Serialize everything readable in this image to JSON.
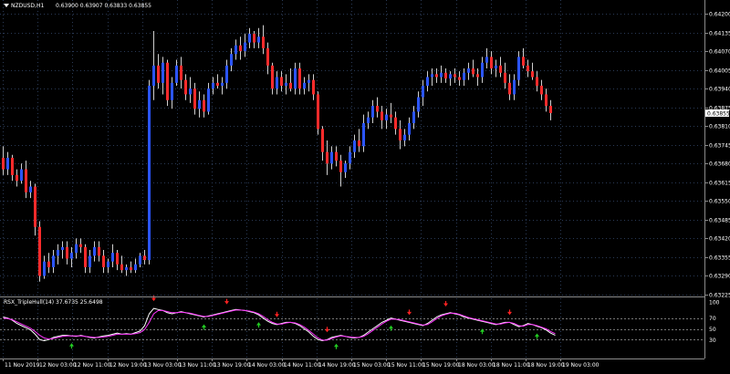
{
  "main": {
    "header": {
      "symbol": "NZDUSD,H1",
      "ohlc": "0.63900 0.63907 0.63833 0.63855"
    },
    "price_axis": [
      "0.64200",
      "0.64135",
      "0.64070",
      "0.64005",
      "0.63940",
      "0.63875",
      "0.63810",
      "0.63745",
      "0.63680",
      "0.63615",
      "0.63550",
      "0.63485",
      "0.63420",
      "0.63355",
      "0.63290",
      "0.63225"
    ],
    "current_price": "0.63855"
  },
  "indicator": {
    "title": "RSX_TripleHull(14) 37.6735 25.6498",
    "levels": [
      "100",
      "70",
      "50",
      "30"
    ]
  },
  "time_axis": [
    "11 Nov 2019",
    "12 Nov 03:00",
    "12 Nov 11:00",
    "12 Nov 19:00",
    "13 Nov 03:00",
    "13 Nov 11:00",
    "13 Nov 19:00",
    "14 Nov 03:00",
    "14 Nov 11:00",
    "14 Nov 19:00",
    "15 Nov 03:00",
    "15 Nov 11:00",
    "15 Nov 19:00",
    "18 Nov 03:00",
    "18 Nov 11:00",
    "18 Nov 19:00",
    "19 Nov 03:00"
  ],
  "colors": {
    "bull": "#2b55ff",
    "bear": "#ff2b2b",
    "grid": "#2a3a56",
    "rsx": "#ffffff",
    "signal": "#ff33ff",
    "arrow_up": "#22cc22",
    "arrow_down": "#ff2222"
  },
  "chart_data": [
    {
      "type": "candlestick",
      "title": "NZDUSD,H1",
      "x_start": "11 Nov 2019",
      "ylim": [
        0.63225,
        0.642
      ],
      "ohlc": [
        [
          0.637,
          0.6374,
          0.6364,
          0.6366
        ],
        [
          0.6366,
          0.6372,
          0.6364,
          0.637
        ],
        [
          0.637,
          0.6371,
          0.6362,
          0.6364
        ],
        [
          0.6364,
          0.6366,
          0.636,
          0.6362
        ],
        [
          0.6362,
          0.6368,
          0.6361,
          0.6366
        ],
        [
          0.6366,
          0.6369,
          0.6356,
          0.6358
        ],
        [
          0.6358,
          0.6362,
          0.6356,
          0.636
        ],
        [
          0.636,
          0.6361,
          0.6343,
          0.6346
        ],
        [
          0.6346,
          0.6348,
          0.6327,
          0.6329
        ],
        [
          0.6329,
          0.6336,
          0.6328,
          0.6334
        ],
        [
          0.6334,
          0.6337,
          0.633,
          0.6332
        ],
        [
          0.6332,
          0.6338,
          0.633,
          0.6336
        ],
        [
          0.6336,
          0.634,
          0.6333,
          0.6338
        ],
        [
          0.6338,
          0.6341,
          0.6335,
          0.6339
        ],
        [
          0.6339,
          0.6341,
          0.6333,
          0.6335
        ],
        [
          0.6335,
          0.6339,
          0.6332,
          0.6337
        ],
        [
          0.6337,
          0.6342,
          0.6335,
          0.634
        ],
        [
          0.634,
          0.6342,
          0.6337,
          0.6339
        ],
        [
          0.6339,
          0.634,
          0.633,
          0.6332
        ],
        [
          0.6332,
          0.6338,
          0.633,
          0.6336
        ],
        [
          0.6336,
          0.6341,
          0.6334,
          0.6339
        ],
        [
          0.6339,
          0.6341,
          0.6334,
          0.6336
        ],
        [
          0.6336,
          0.6338,
          0.633,
          0.6332
        ],
        [
          0.6332,
          0.6335,
          0.633,
          0.6334
        ],
        [
          0.6334,
          0.634,
          0.6332,
          0.6337
        ],
        [
          0.6337,
          0.6338,
          0.6331,
          0.6333
        ],
        [
          0.6333,
          0.6336,
          0.633,
          0.6331
        ],
        [
          0.6331,
          0.6333,
          0.6329,
          0.6332
        ],
        [
          0.6332,
          0.6334,
          0.633,
          0.6331
        ],
        [
          0.6331,
          0.6335,
          0.633,
          0.6333
        ],
        [
          0.6333,
          0.6337,
          0.6332,
          0.6336
        ],
        [
          0.6336,
          0.6338,
          0.6333,
          0.63345
        ],
        [
          0.63345,
          0.6397,
          0.6333,
          0.6395
        ],
        [
          0.6395,
          0.6414,
          0.639,
          0.6402
        ],
        [
          0.6402,
          0.6406,
          0.6394,
          0.6396
        ],
        [
          0.6396,
          0.6405,
          0.6392,
          0.6403
        ],
        [
          0.6403,
          0.6404,
          0.6388,
          0.639
        ],
        [
          0.639,
          0.6398,
          0.6387,
          0.6396
        ],
        [
          0.6396,
          0.6404,
          0.6395,
          0.6402
        ],
        [
          0.6402,
          0.6405,
          0.6394,
          0.6397
        ],
        [
          0.6397,
          0.6399,
          0.639,
          0.6392
        ],
        [
          0.6392,
          0.6398,
          0.6389,
          0.6394
        ],
        [
          0.6394,
          0.6396,
          0.6385,
          0.6387
        ],
        [
          0.6387,
          0.6393,
          0.6384,
          0.639
        ],
        [
          0.639,
          0.6392,
          0.6384,
          0.6386
        ],
        [
          0.6386,
          0.6396,
          0.6385,
          0.6394
        ],
        [
          0.6394,
          0.6398,
          0.6392,
          0.6396
        ],
        [
          0.6396,
          0.6399,
          0.6394,
          0.6395
        ],
        [
          0.6395,
          0.6398,
          0.6392,
          0.6396
        ],
        [
          0.6396,
          0.6404,
          0.6394,
          0.6402
        ],
        [
          0.6402,
          0.6408,
          0.64,
          0.6406
        ],
        [
          0.6406,
          0.6411,
          0.6404,
          0.6409
        ],
        [
          0.6409,
          0.6412,
          0.6404,
          0.6407
        ],
        [
          0.6407,
          0.6413,
          0.6405,
          0.641
        ],
        [
          0.641,
          0.6415,
          0.6408,
          0.6413
        ],
        [
          0.6413,
          0.6414,
          0.6408,
          0.641
        ],
        [
          0.641,
          0.6415,
          0.6408,
          0.6412
        ],
        [
          0.6412,
          0.6416,
          0.6406,
          0.6408
        ],
        [
          0.6408,
          0.641,
          0.6399,
          0.6402
        ],
        [
          0.6402,
          0.6403,
          0.6392,
          0.6394
        ],
        [
          0.6394,
          0.64,
          0.6392,
          0.6398
        ],
        [
          0.6398,
          0.64,
          0.6393,
          0.6395
        ],
        [
          0.6395,
          0.6399,
          0.6392,
          0.6396
        ],
        [
          0.6396,
          0.6401,
          0.6393,
          0.6394
        ],
        [
          0.6394,
          0.6403,
          0.6392,
          0.6401
        ],
        [
          0.6401,
          0.6403,
          0.6392,
          0.6394
        ],
        [
          0.6394,
          0.6398,
          0.6392,
          0.6396
        ],
        [
          0.6396,
          0.6399,
          0.6393,
          0.6397
        ],
        [
          0.6397,
          0.6399,
          0.639,
          0.6392
        ],
        [
          0.6392,
          0.6393,
          0.6378,
          0.638
        ],
        [
          0.638,
          0.6381,
          0.6369,
          0.6372
        ],
        [
          0.6372,
          0.6376,
          0.6364,
          0.6368
        ],
        [
          0.6368,
          0.6374,
          0.6366,
          0.6372
        ],
        [
          0.6372,
          0.6374,
          0.6367,
          0.6369
        ],
        [
          0.6369,
          0.6371,
          0.636,
          0.6365
        ],
        [
          0.6365,
          0.6369,
          0.6363,
          0.6368
        ],
        [
          0.6368,
          0.6374,
          0.6366,
          0.6372
        ],
        [
          0.6372,
          0.6378,
          0.637,
          0.6376
        ],
        [
          0.6376,
          0.638,
          0.6372,
          0.6374
        ],
        [
          0.6374,
          0.6385,
          0.6372,
          0.6382
        ],
        [
          0.6382,
          0.6386,
          0.638,
          0.6384
        ],
        [
          0.6384,
          0.639,
          0.6382,
          0.6388
        ],
        [
          0.6388,
          0.6391,
          0.6384,
          0.6386
        ],
        [
          0.6386,
          0.6388,
          0.638,
          0.6383
        ],
        [
          0.6383,
          0.6387,
          0.638,
          0.6385
        ],
        [
          0.6385,
          0.6389,
          0.6382,
          0.6384
        ],
        [
          0.6384,
          0.6386,
          0.6378,
          0.638
        ],
        [
          0.638,
          0.6383,
          0.6373,
          0.6376
        ],
        [
          0.6376,
          0.638,
          0.6374,
          0.6378
        ],
        [
          0.6378,
          0.6384,
          0.6376,
          0.6382
        ],
        [
          0.6382,
          0.6388,
          0.638,
          0.6386
        ],
        [
          0.6386,
          0.6393,
          0.6384,
          0.6391
        ],
        [
          0.6391,
          0.6397,
          0.6388,
          0.6395
        ],
        [
          0.6395,
          0.64,
          0.6393,
          0.6398
        ],
        [
          0.6398,
          0.6401,
          0.6395,
          0.6399
        ],
        [
          0.6399,
          0.6401,
          0.6396,
          0.6398
        ],
        [
          0.6398,
          0.6402,
          0.6396,
          0.63995
        ],
        [
          0.63995,
          0.6401,
          0.6396,
          0.63975
        ],
        [
          0.63975,
          0.64,
          0.6395,
          0.6399
        ],
        [
          0.6399,
          0.6401,
          0.6396,
          0.6398
        ],
        [
          0.6398,
          0.64,
          0.6395,
          0.6397
        ],
        [
          0.6397,
          0.6401,
          0.6395,
          0.63995
        ],
        [
          0.63995,
          0.6403,
          0.6397,
          0.6401
        ],
        [
          0.6401,
          0.6404,
          0.6398,
          0.6399
        ],
        [
          0.6399,
          0.6401,
          0.6395,
          0.6398
        ],
        [
          0.6398,
          0.6405,
          0.6396,
          0.6403
        ],
        [
          0.6403,
          0.6408,
          0.6401,
          0.6405
        ],
        [
          0.6405,
          0.6407,
          0.6399,
          0.6401
        ],
        [
          0.6401,
          0.6404,
          0.6398,
          0.6402
        ],
        [
          0.6402,
          0.6405,
          0.6398,
          0.63995
        ],
        [
          0.63995,
          0.6403,
          0.6394,
          0.6396
        ],
        [
          0.6396,
          0.6399,
          0.639,
          0.6392
        ],
        [
          0.6392,
          0.6399,
          0.639,
          0.6397
        ],
        [
          0.6397,
          0.6407,
          0.6395,
          0.6405
        ],
        [
          0.6405,
          0.6408,
          0.6401,
          0.6402
        ],
        [
          0.6402,
          0.6404,
          0.6398,
          0.64
        ],
        [
          0.64,
          0.6403,
          0.6397,
          0.6398
        ],
        [
          0.6398,
          0.64,
          0.6393,
          0.6395
        ],
        [
          0.6395,
          0.6397,
          0.639,
          0.6392
        ],
        [
          0.6392,
          0.6394,
          0.6386,
          0.6388
        ],
        [
          0.6388,
          0.639,
          0.6383,
          0.63855
        ]
      ]
    },
    {
      "type": "line",
      "title": "RSX_TripleHull(14) 37.6735 25.6498",
      "ylim": [
        0,
        100
      ],
      "levels": [
        100,
        70,
        50,
        30
      ],
      "series": [
        {
          "values": [
            72,
            70,
            66,
            60,
            56,
            52,
            48,
            40,
            30,
            28,
            30,
            34,
            36,
            38,
            38,
            37,
            36,
            38,
            36,
            34,
            33,
            35,
            37,
            38,
            40,
            42,
            40,
            41,
            40,
            43,
            46,
            56,
            78,
            88,
            86,
            84,
            80,
            78,
            80,
            82,
            80,
            78,
            76,
            74,
            72,
            74,
            76,
            78,
            80,
            82,
            84,
            86,
            85,
            84,
            82,
            80,
            76,
            70,
            64,
            60,
            58,
            60,
            62,
            62,
            60,
            56,
            50,
            44,
            36,
            30,
            28,
            30,
            34,
            36,
            38,
            36,
            34,
            33,
            34,
            38,
            44,
            50,
            56,
            62,
            66,
            70,
            68,
            66,
            64,
            62,
            60,
            58,
            56,
            60,
            66,
            72,
            76,
            78,
            80,
            78,
            76,
            72,
            70,
            68,
            66,
            64,
            62,
            60,
            58,
            60,
            62,
            62,
            58,
            54,
            56,
            60,
            58,
            55,
            52,
            48,
            42,
            38
          ]
        },
        {
          "values": [
            70,
            69,
            67,
            63,
            59,
            55,
            51,
            45,
            38,
            33,
            31,
            32,
            34,
            36,
            37,
            37,
            37,
            37,
            36,
            35,
            34,
            34,
            35,
            36,
            38,
            40,
            40,
            40,
            40,
            41,
            43,
            49,
            62,
            78,
            84,
            84,
            82,
            80,
            80,
            81,
            80,
            79,
            77,
            75,
            73,
            73,
            75,
            77,
            79,
            81,
            83,
            85,
            85,
            84,
            83,
            81,
            78,
            73,
            67,
            62,
            59,
            59,
            61,
            62,
            61,
            58,
            53,
            47,
            40,
            33,
            29,
            29,
            32,
            35,
            37,
            36,
            35,
            34,
            34,
            36,
            41,
            47,
            53,
            59,
            64,
            68,
            68,
            67,
            65,
            63,
            61,
            59,
            57,
            58,
            63,
            69,
            74,
            77,
            79,
            79,
            77,
            74,
            71,
            69,
            67,
            65,
            63,
            61,
            59,
            59,
            61,
            62,
            60,
            56,
            55,
            58,
            58,
            56,
            53,
            50,
            45,
            41
          ]
        }
      ],
      "arrows_up": [
        15,
        44,
        56,
        73,
        85,
        105,
        117,
        128
      ],
      "arrows_down": [
        33,
        49,
        60,
        71,
        89,
        97,
        111,
        125
      ]
    }
  ]
}
